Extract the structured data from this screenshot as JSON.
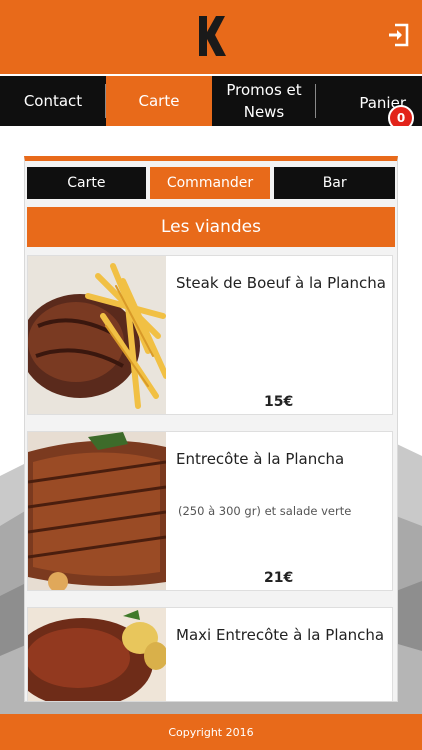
{
  "header": {
    "logo_letter": "K",
    "brand_color": "#e86a1a",
    "exit_icon": "exit-icon"
  },
  "mainnav": {
    "items": [
      {
        "label": "Contact"
      },
      {
        "label": "Carte"
      },
      {
        "label": "Promos et News"
      },
      {
        "label": "Panier"
      }
    ],
    "active": "Carte",
    "cart_count": "0"
  },
  "subtabs": {
    "items": [
      {
        "label": "Carte"
      },
      {
        "label": "Commander"
      },
      {
        "label": "Bar"
      }
    ],
    "active": "Commander"
  },
  "section": {
    "title": "Les viandes"
  },
  "items": [
    {
      "name": "Steak de Boeuf à la Plancha",
      "desc": "",
      "price": "15€"
    },
    {
      "name": "Entrecôte à la Plancha",
      "desc": "(250 à 300 gr) et salade verte",
      "price": "21€"
    },
    {
      "name": "Maxi Entrecôte à la Plancha",
      "desc": "",
      "price": ""
    }
  ],
  "footer": {
    "text": "Copyright 2016"
  }
}
